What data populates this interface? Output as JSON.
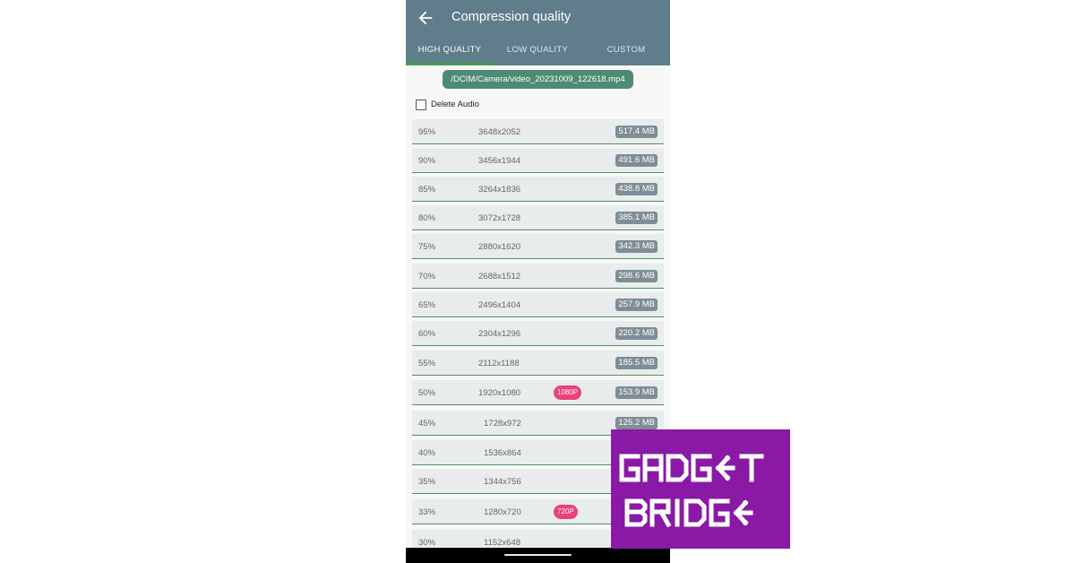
{
  "appbar": {
    "title": "Compression quality",
    "back_icon": "arrow-left-icon",
    "color": "#607d8b"
  },
  "tabs": [
    {
      "label": "HIGH QUALITY",
      "selected": true
    },
    {
      "label": "LOW QUALITY",
      "selected": false
    },
    {
      "label": "CUSTOM",
      "selected": false
    }
  ],
  "file": {
    "path": "/DCIM/Camera/video_20231009_122618.mp4"
  },
  "delete_audio": {
    "label": "Delete Audio",
    "checked": false
  },
  "qualities": [
    {
      "percent": "95%",
      "resolution": "3648x2052",
      "size": "517.4 MB",
      "badge": ""
    },
    {
      "percent": "90%",
      "resolution": "3456x1944",
      "size": "491.6 MB",
      "badge": ""
    },
    {
      "percent": "85%",
      "resolution": "3264x1836",
      "size": "438.8 MB",
      "badge": ""
    },
    {
      "percent": "80%",
      "resolution": "3072x1728",
      "size": "385.1 MB",
      "badge": ""
    },
    {
      "percent": "75%",
      "resolution": "2880x1620",
      "size": "342.3 MB",
      "badge": ""
    },
    {
      "percent": "70%",
      "resolution": "2688x1512",
      "size": "298.6 MB",
      "badge": ""
    },
    {
      "percent": "65%",
      "resolution": "2496x1404",
      "size": "257.9 MB",
      "badge": ""
    },
    {
      "percent": "60%",
      "resolution": "2304x1296",
      "size": "220.2 MB",
      "badge": ""
    },
    {
      "percent": "55%",
      "resolution": "2112x1188",
      "size": "185.5 MB",
      "badge": ""
    },
    {
      "percent": "50%",
      "resolution": "1920x1080",
      "size": "153.9 MB",
      "badge": "1080P"
    },
    {
      "percent": "45%",
      "resolution": "1728x972",
      "size": "125.2 MB",
      "badge": ""
    },
    {
      "percent": "40%",
      "resolution": "1536x864",
      "size": "",
      "badge": ""
    },
    {
      "percent": "35%",
      "resolution": "1344x756",
      "size": "",
      "badge": ""
    },
    {
      "percent": "33%",
      "resolution": "1280x720",
      "size": "",
      "badge": "720P"
    },
    {
      "percent": "30%",
      "resolution": "1152x648",
      "size": "",
      "badge": ""
    }
  ],
  "watermark": {
    "line1": "GADGET",
    "line2": "BRIDGE",
    "color": "#8a19a5"
  }
}
